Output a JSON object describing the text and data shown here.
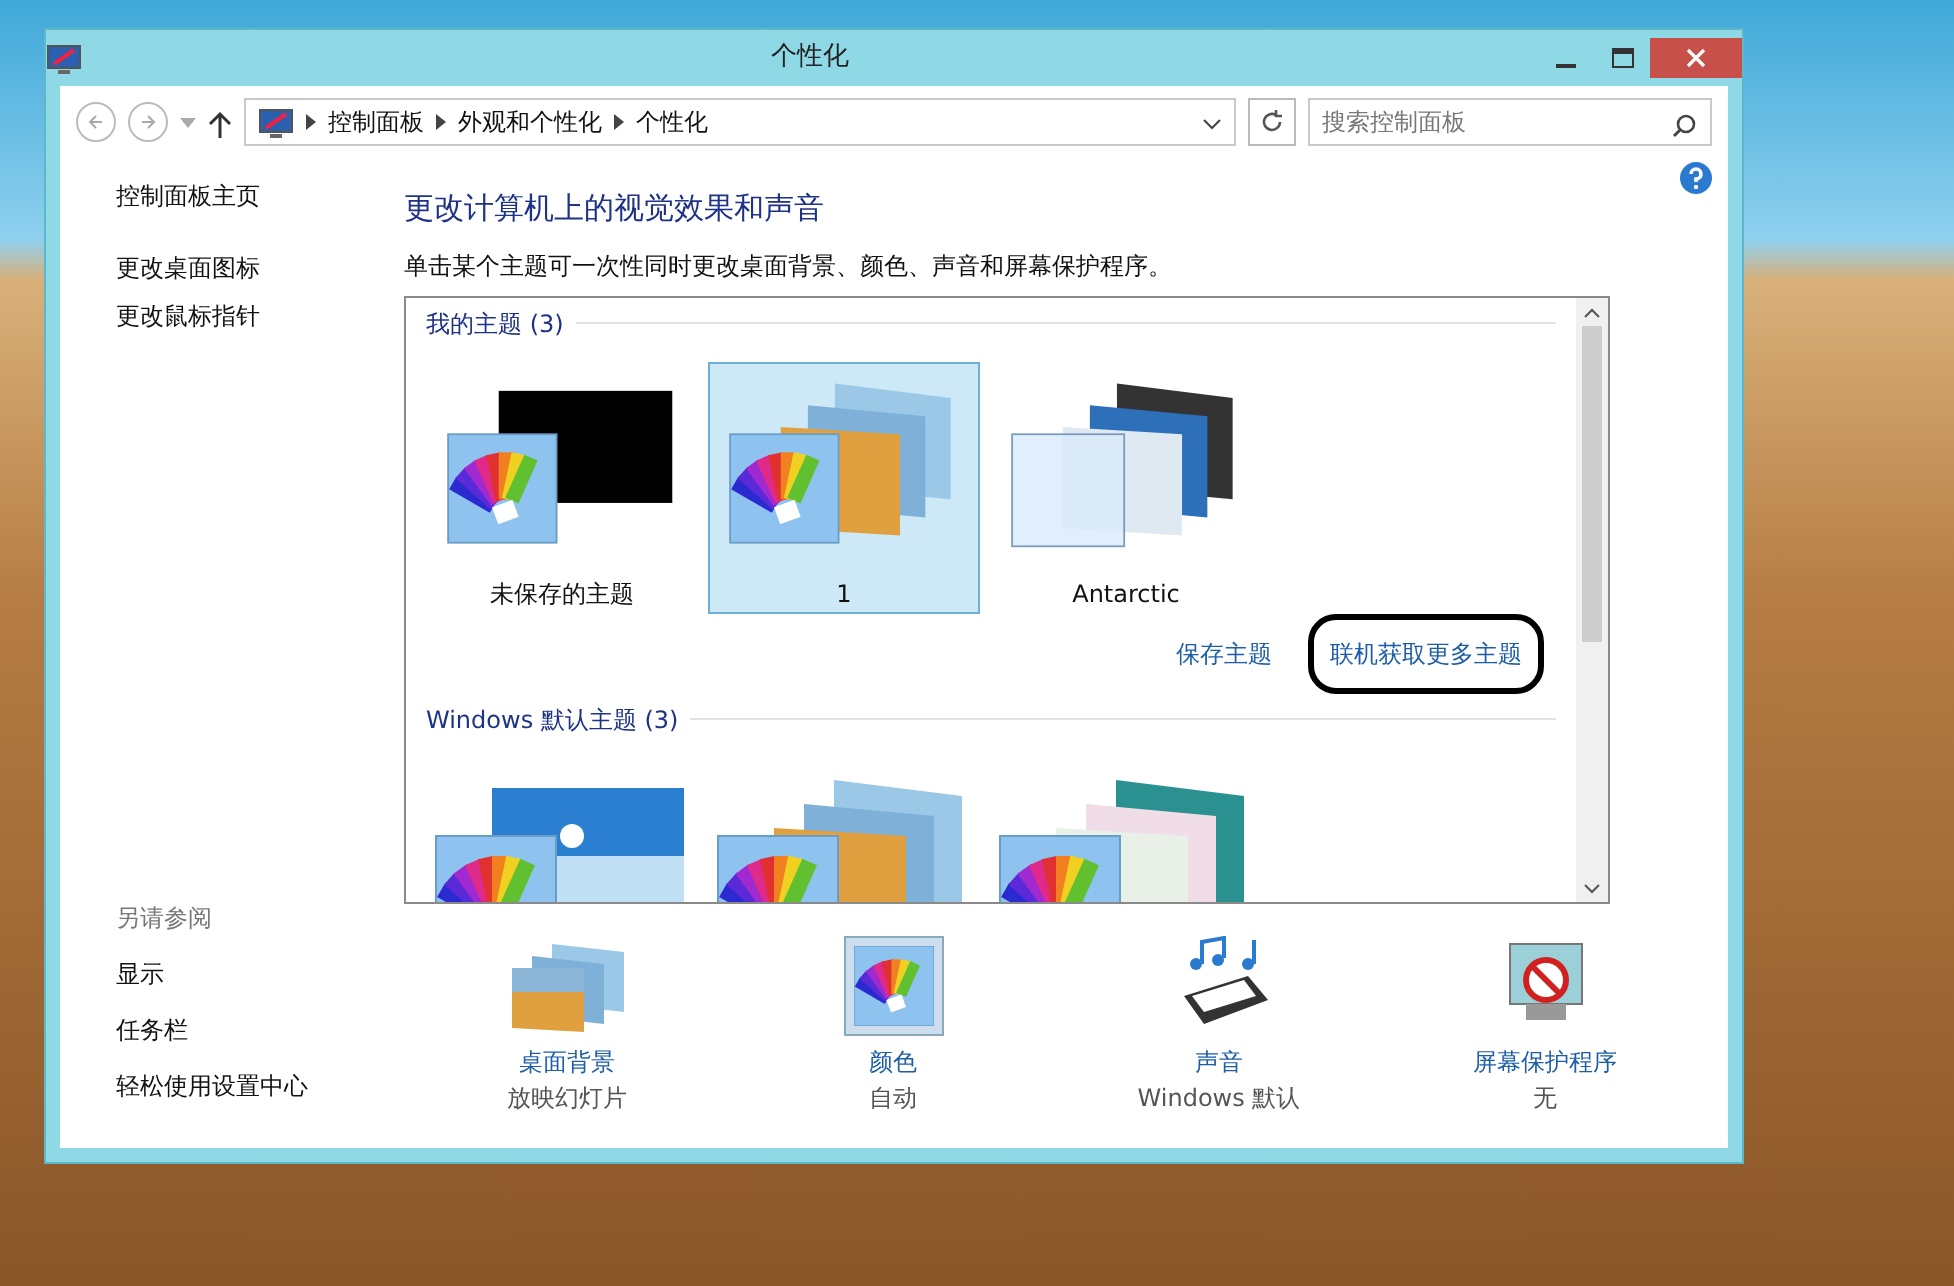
{
  "window": {
    "title": "个性化"
  },
  "address_bar": {
    "crumbs": [
      "控制面板",
      "外观和个性化",
      "个性化"
    ],
    "search_placeholder": "搜索控制面板"
  },
  "sidebar": {
    "items": [
      "控制面板主页",
      "更改桌面图标",
      "更改鼠标指针"
    ],
    "see_also_heading": "另请参阅",
    "see_also": [
      "显示",
      "任务栏",
      "轻松使用设置中心"
    ]
  },
  "heading": "更改计算机上的视觉效果和声音",
  "description": "单击某个主题可一次性同时更改桌面背景、颜色、声音和屏幕保护程序。",
  "my_themes": {
    "heading": "我的主题 (3)",
    "themes": [
      {
        "name": "未保存的主题",
        "kind": "black",
        "selected": false
      },
      {
        "name": "1",
        "kind": "landscape",
        "selected": true
      },
      {
        "name": "Antarctic",
        "kind": "antarctic",
        "selected": false
      }
    ],
    "links": [
      {
        "label": "保存主题",
        "circled": false
      },
      {
        "label": "联机获取更多主题",
        "circled": true
      }
    ]
  },
  "default_themes": {
    "heading": "Windows 默认主题 (3)",
    "themes": [
      {
        "kind": "windows",
        "selected": false
      },
      {
        "kind": "landscape",
        "selected": false
      },
      {
        "kind": "flower",
        "selected": false
      }
    ]
  },
  "settings": [
    {
      "kind": "background",
      "label": "桌面背景",
      "value": "放映幻灯片"
    },
    {
      "kind": "color",
      "label": "颜色",
      "value": "自动"
    },
    {
      "kind": "sound",
      "label": "声音",
      "value": "Windows 默认"
    },
    {
      "kind": "screensaver",
      "label": "屏幕保护程序",
      "value": "无"
    }
  ]
}
